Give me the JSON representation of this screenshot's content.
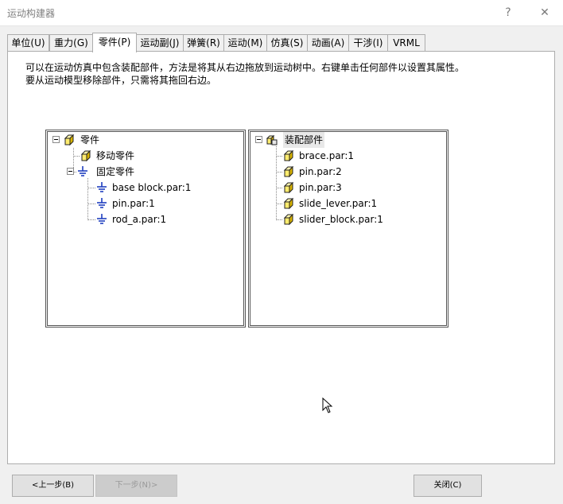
{
  "window": {
    "title": "运动构建器",
    "help_label": "?",
    "close_label": "✕"
  },
  "tabs": [
    {
      "label": "单位(U)"
    },
    {
      "label": "重力(G)"
    },
    {
      "label": "零件(P)",
      "active": true
    },
    {
      "label": "运动副(J)"
    },
    {
      "label": "弹簧(R)"
    },
    {
      "label": "运动(M)"
    },
    {
      "label": "仿真(S)"
    },
    {
      "label": "动画(A)"
    },
    {
      "label": "干涉(I)"
    },
    {
      "label": "VRML"
    }
  ],
  "description": {
    "line1": "可以在运动仿真中包含装配部件，方法是将其从右边拖放到运动树中。右键单击任何部件以设置其属性。",
    "line2": "要从运动模型移除部件，只需将其拖回右边。"
  },
  "motion_tree": {
    "root": "零件",
    "moving": "移动零件",
    "fixed": "固定零件",
    "fixed_parts": [
      "base block.par:1",
      "pin.par:1",
      "rod_a.par:1"
    ]
  },
  "assembly_tree": {
    "root": "装配部件",
    "parts": [
      "brace.par:1",
      "pin.par:2",
      "pin.par:3",
      "slide_lever.par:1",
      "slider_block.par:1"
    ]
  },
  "buttons": {
    "prev": "<上一步(B)",
    "next": "下一步(N)>",
    "close": "关闭(C)"
  },
  "icons": {
    "part": "part-cube-icon",
    "assembly": "assembly-icon",
    "ground": "ground-icon",
    "expand": "collapse-minus-icon"
  },
  "colors": {
    "part_fill": "#ffec6e",
    "ground_blue": "#1f3fbf",
    "window_bg": "#f0f0f0"
  }
}
